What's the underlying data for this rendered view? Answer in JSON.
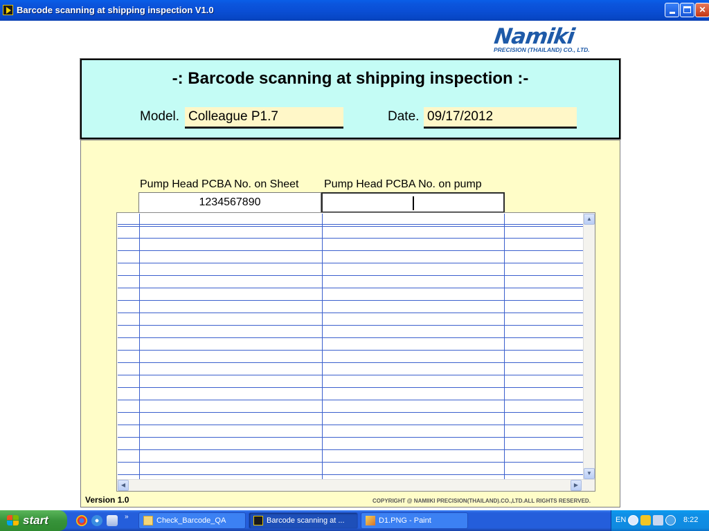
{
  "window": {
    "title": "Barcode scanning at shipping inspection V1.0",
    "controls": {
      "minimize": "_",
      "maximize": "□",
      "close": "✕"
    }
  },
  "logo": {
    "name": "Namiki",
    "subtitle": "PRECISION (THAILAND) CO., LTD."
  },
  "header": {
    "title": "-: Barcode scanning at shipping inspection :-",
    "model_label": "Model.",
    "model_value": "Colleague P1.7",
    "date_label": "Date.",
    "date_value": "09/17/2012"
  },
  "scan": {
    "col1_header": "Pump Head PCBA No. on Sheet",
    "col2_header": "Pump Head PCBA No. on pump",
    "sheet_value": "1234567890",
    "pump_value": ""
  },
  "footer": {
    "version": "Version 1.0",
    "copyright": "COPYRIGHT @    NAMIIKI PRECISION(THAILAND).CO.,LTD.ALL RIGHTS RESERVED."
  },
  "taskbar": {
    "start_label": "start",
    "tasks": [
      {
        "label": "Check_Barcode_QA",
        "icon": "folder-icon"
      },
      {
        "label": "Barcode scanning at ...",
        "icon": "labview-icon"
      },
      {
        "label": "D1.PNG - Paint",
        "icon": "paint-icon"
      }
    ],
    "language": "EN",
    "clock": "8:22"
  },
  "colors": {
    "header_bg": "#c4fcf5",
    "panel_bg": "#fffdc8",
    "value_bg": "#fff7c8",
    "logo_blue": "#1e5aa8",
    "grid_line": "#3a5fcd"
  }
}
